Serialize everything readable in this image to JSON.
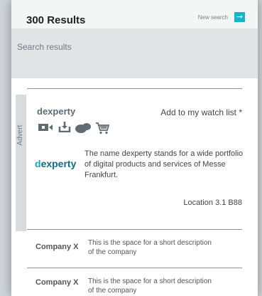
{
  "header": {
    "results_title": "300 Results",
    "new_search_label": "New search",
    "go_icon": "arrow-right-icon",
    "accent_color": "#12b5c9"
  },
  "search": {
    "placeholder": "Search results"
  },
  "advert": {
    "label": "Advert",
    "brand_name": "dexperty",
    "watch_label": "Add to my watch list *",
    "icons": [
      "video-icon",
      "download-icon",
      "chat-icon",
      "cart-icon"
    ],
    "logo_prefix": "d",
    "logo_rest": "experty",
    "description": "The name dexperty stands for a wide portfolio of digital products and services of Messe Frankfurt.",
    "location": "Location 3.1 B88"
  },
  "companies": [
    {
      "name": "Company X",
      "description": "This is the space for a short description of the company"
    },
    {
      "name": "Company X",
      "description": "This is the space for a short description of the company"
    }
  ]
}
